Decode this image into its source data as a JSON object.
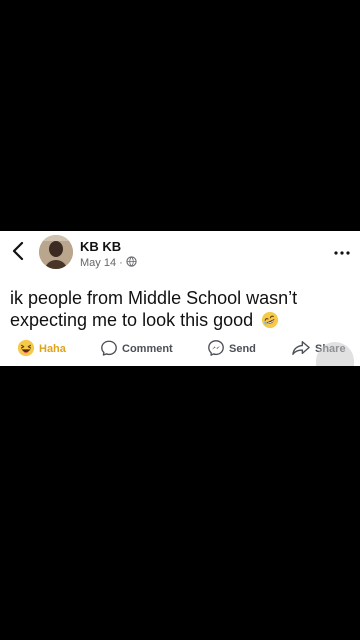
{
  "post": {
    "author": "KB KB",
    "date": "May 14",
    "separator": "·",
    "text": "ik people from Middle School wasn’t expecting me to look this good"
  },
  "icons": {
    "back": "chevron-left-icon",
    "more": "more-dots-icon",
    "privacy": "globe-icon",
    "emoji": "rofl-emoji-icon",
    "haha": "haha-reaction-icon",
    "comment": "comment-icon",
    "send": "messenger-icon",
    "share": "share-arrow-icon"
  },
  "actions": {
    "haha_label": "Haha",
    "comment_label": "Comment",
    "send_label": "Send",
    "share_label": "Share"
  },
  "colors": {
    "background": "#000000",
    "card": "#ffffff",
    "haha": "#e0a31c",
    "muted": "#65676b"
  }
}
